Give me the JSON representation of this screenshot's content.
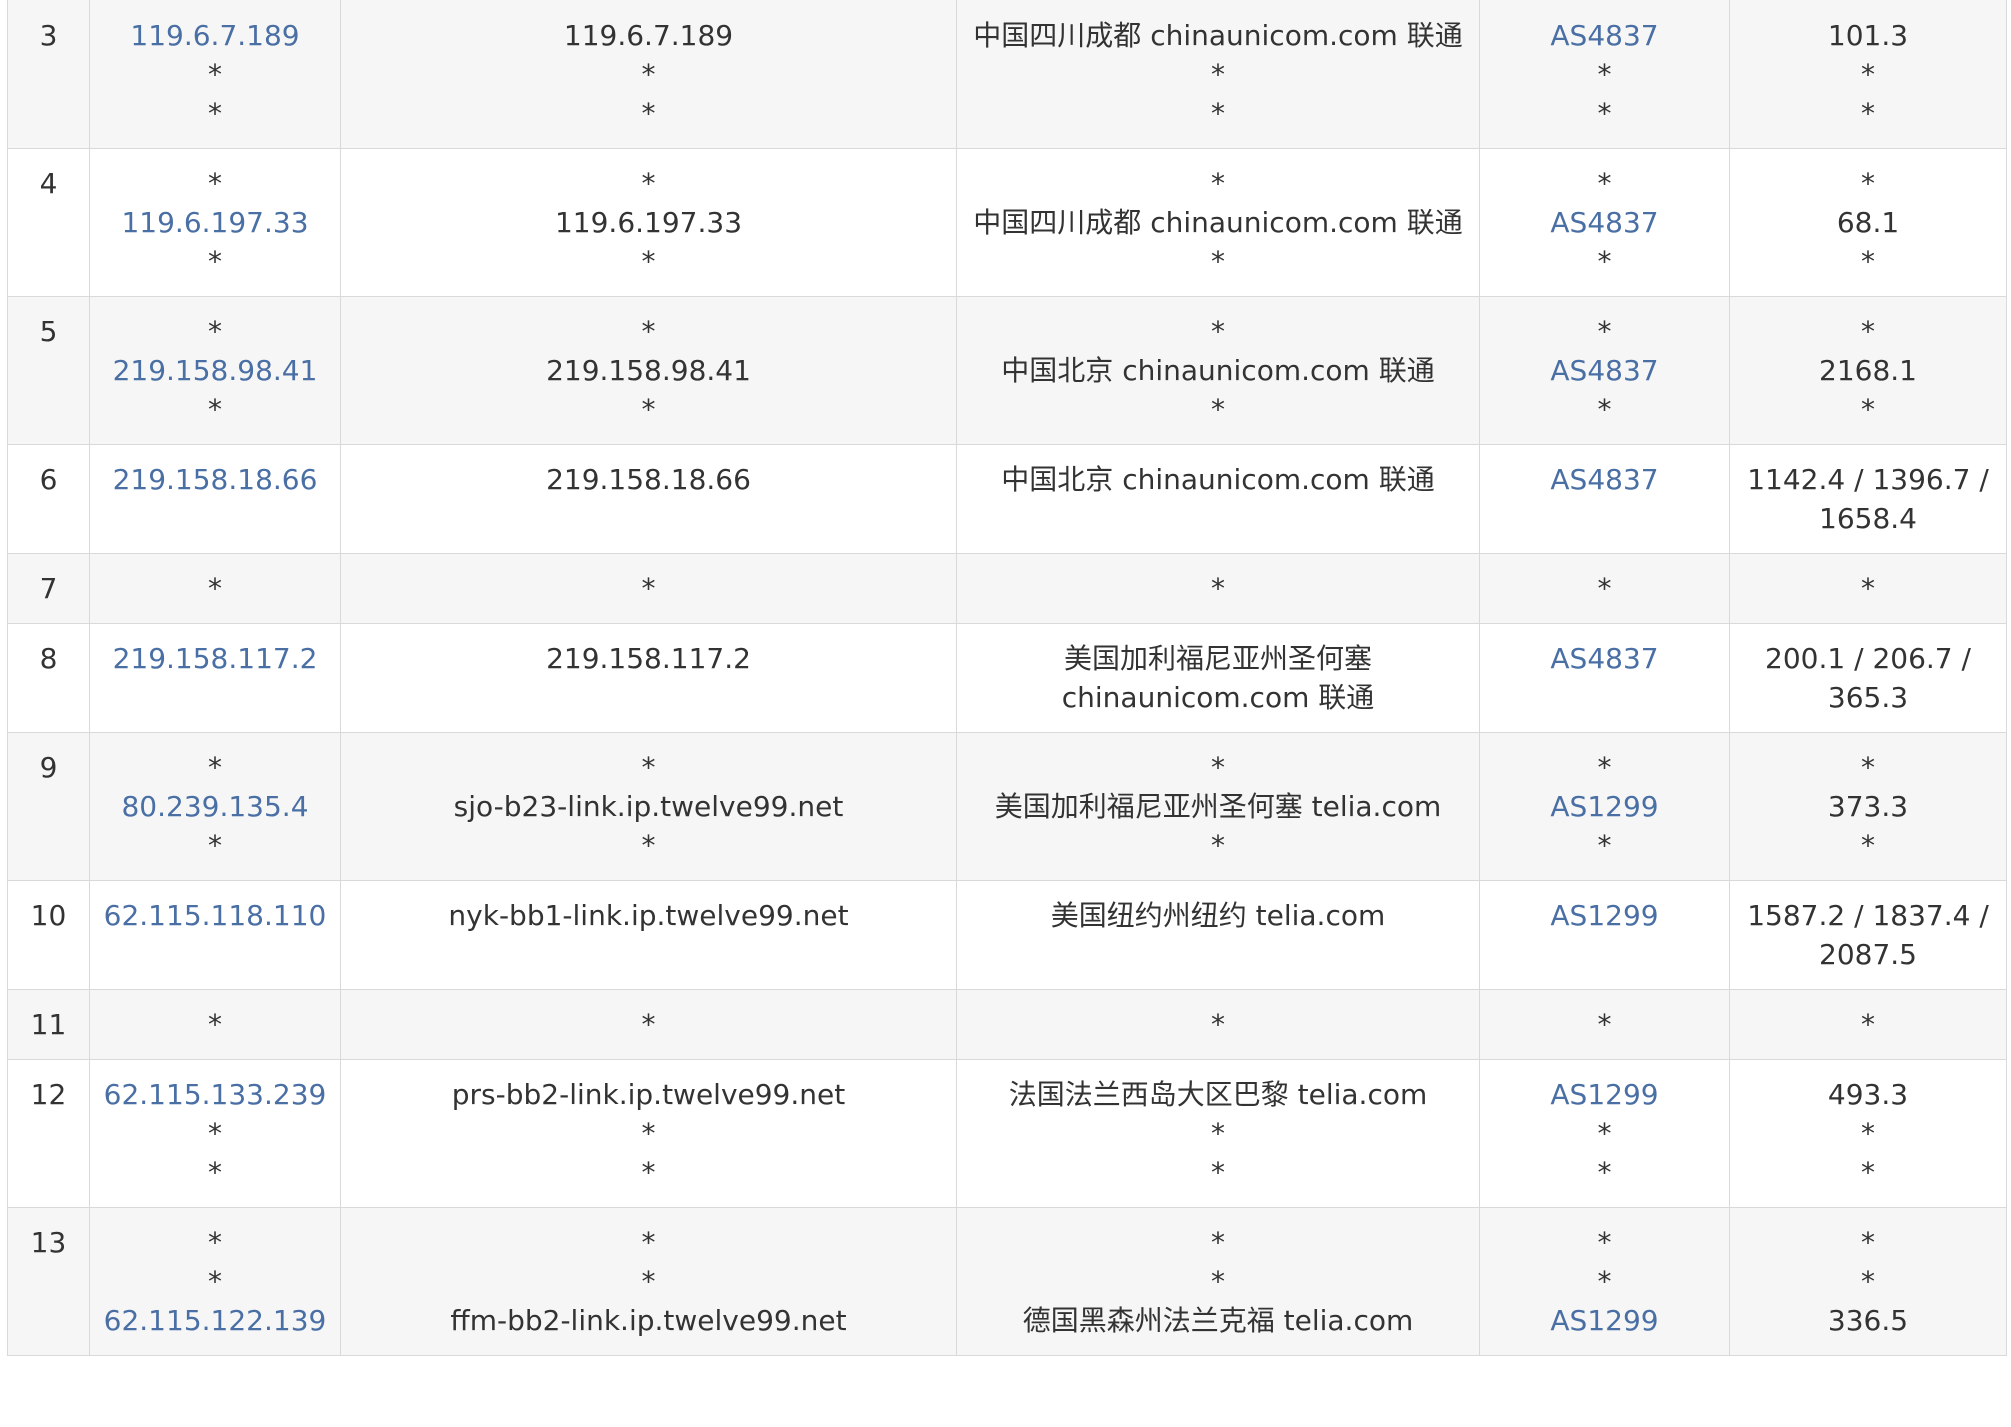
{
  "colors": {
    "link": "#4a6fa5",
    "text": "#333333",
    "row_odd": "#f6f6f6",
    "row_even": "#ffffff",
    "border": "#d9d9d9"
  },
  "rows": [
    {
      "hop": "3",
      "ip": [
        "119.6.7.189",
        "*",
        "*"
      ],
      "host": [
        "119.6.7.189",
        "*",
        "*"
      ],
      "location": [
        "中国四川成都 chinaunicom.com 联通",
        "*",
        "*"
      ],
      "asn": [
        "AS4837",
        "*",
        "*"
      ],
      "rtt": [
        "101.3",
        "*",
        "*"
      ]
    },
    {
      "hop": "4",
      "ip": [
        "*",
        "119.6.197.33",
        "*"
      ],
      "host": [
        "*",
        "119.6.197.33",
        "*"
      ],
      "location": [
        "*",
        "中国四川成都 chinaunicom.com 联通",
        "*"
      ],
      "asn": [
        "*",
        "AS4837",
        "*"
      ],
      "rtt": [
        "*",
        "68.1",
        "*"
      ]
    },
    {
      "hop": "5",
      "ip": [
        "*",
        "219.158.98.41",
        "*"
      ],
      "host": [
        "*",
        "219.158.98.41",
        "*"
      ],
      "location": [
        "*",
        "中国北京 chinaunicom.com 联通",
        "*"
      ],
      "asn": [
        "*",
        "AS4837",
        "*"
      ],
      "rtt": [
        "*",
        "2168.1",
        "*"
      ]
    },
    {
      "hop": "6",
      "ip": [
        "219.158.18.66"
      ],
      "host": [
        "219.158.18.66"
      ],
      "location": [
        "中国北京 chinaunicom.com 联通"
      ],
      "asn": [
        "AS4837"
      ],
      "rtt": [
        "1142.4 / 1396.7 /",
        "1658.4"
      ]
    },
    {
      "hop": "7",
      "ip": [
        "*"
      ],
      "host": [
        "*"
      ],
      "location": [
        "*"
      ],
      "asn": [
        "*"
      ],
      "rtt": [
        "*"
      ]
    },
    {
      "hop": "8",
      "ip": [
        "219.158.117.2"
      ],
      "host": [
        "219.158.117.2"
      ],
      "location": [
        "美国加利福尼亚州圣何塞",
        "chinaunicom.com 联通"
      ],
      "asn": [
        "AS4837"
      ],
      "rtt": [
        "200.1 / 206.7 /",
        "365.3"
      ]
    },
    {
      "hop": "9",
      "ip": [
        "*",
        "80.239.135.4",
        "*"
      ],
      "host": [
        "*",
        "sjo-b23-link.ip.twelve99.net",
        "*"
      ],
      "location": [
        "*",
        "美国加利福尼亚州圣何塞 telia.com",
        "*"
      ],
      "asn": [
        "*",
        "AS1299",
        "*"
      ],
      "rtt": [
        "*",
        "373.3",
        "*"
      ]
    },
    {
      "hop": "10",
      "ip": [
        "62.115.118.110"
      ],
      "host": [
        "nyk-bb1-link.ip.twelve99.net"
      ],
      "location": [
        "美国纽约州纽约 telia.com"
      ],
      "asn": [
        "AS1299"
      ],
      "rtt": [
        "1587.2 / 1837.4 /",
        "2087.5"
      ]
    },
    {
      "hop": "11",
      "ip": [
        "*"
      ],
      "host": [
        "*"
      ],
      "location": [
        "*"
      ],
      "asn": [
        "*"
      ],
      "rtt": [
        "*"
      ]
    },
    {
      "hop": "12",
      "ip": [
        "62.115.133.239",
        "*",
        "*"
      ],
      "host": [
        "prs-bb2-link.ip.twelve99.net",
        "*",
        "*"
      ],
      "location": [
        "法国法兰西岛大区巴黎 telia.com",
        "*",
        "*"
      ],
      "asn": [
        "AS1299",
        "*",
        "*"
      ],
      "rtt": [
        "493.3",
        "*",
        "*"
      ]
    },
    {
      "hop": "13",
      "ip": [
        "*",
        "*",
        "62.115.122.139"
      ],
      "host": [
        "*",
        "*",
        "ffm-bb2-link.ip.twelve99.net"
      ],
      "location": [
        "*",
        "*",
        "德国黑森州法兰克福 telia.com"
      ],
      "asn": [
        "*",
        "*",
        "AS1299"
      ],
      "rtt": [
        "*",
        "*",
        "336.5"
      ]
    }
  ]
}
